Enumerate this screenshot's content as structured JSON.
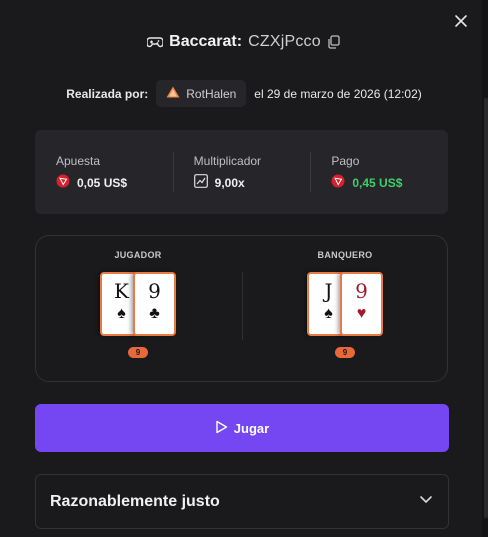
{
  "title": {
    "game": "Baccarat:",
    "code": "CZXjPcco"
  },
  "meta": {
    "label": "Realizada por:",
    "user": "RotHalen",
    "date": "el 29 de marzo de 2026 (12:02)"
  },
  "stats": [
    {
      "label": "Apuesta",
      "value": "0,05 US$",
      "icon": "trx-coin-icon"
    },
    {
      "label": "Multiplicador",
      "value": "9,00x",
      "icon": "chart-icon"
    },
    {
      "label": "Pago",
      "value": "0,45 US$",
      "icon": "trx-coin-icon"
    }
  ],
  "game": {
    "player": {
      "label": "JUGADOR",
      "cards": [
        {
          "rank": "K",
          "suit": "♠"
        },
        {
          "rank": "9",
          "suit": "♣"
        }
      ],
      "score": "9"
    },
    "banker": {
      "label": "BANQUERO",
      "cards": [
        {
          "rank": "J",
          "suit": "♠"
        },
        {
          "rank": "9",
          "suit": "♥"
        }
      ],
      "score": "9"
    }
  },
  "play_button": {
    "label": "Jugar"
  },
  "fair": {
    "label": "Razonablemente justo"
  },
  "colors": {
    "accent": "#7447f2",
    "payout_green": "#3fcf6a",
    "score_badge": "#e8683a",
    "card_border": "#e87a45"
  }
}
